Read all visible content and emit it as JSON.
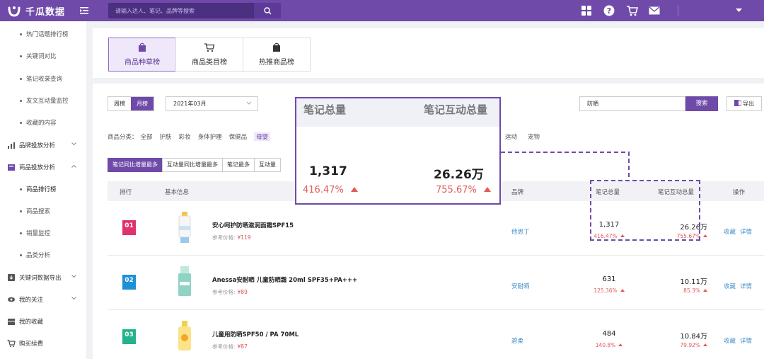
{
  "app": {
    "brand": "千瓜数据"
  },
  "search": {
    "placeholder": "请输入达人、笔记、品牌等搜索"
  },
  "sidebar": {
    "items": [
      {
        "label": "热门话题排行榜",
        "type": "sub"
      },
      {
        "label": "关键词对比",
        "type": "sub"
      },
      {
        "label": "笔记收录查询",
        "type": "sub"
      },
      {
        "label": "发文互动量监控",
        "type": "sub"
      },
      {
        "label": "收藏的内容",
        "type": "sub"
      },
      {
        "label": "品牌投放分析",
        "type": "group"
      },
      {
        "label": "商品投放分析",
        "type": "group"
      },
      {
        "label": "商品排行榜",
        "type": "sub"
      },
      {
        "label": "商品搜索",
        "type": "sub"
      },
      {
        "label": "销量监控",
        "type": "sub"
      },
      {
        "label": "品类分析",
        "type": "sub"
      },
      {
        "label": "关键词数据导出",
        "type": "group"
      },
      {
        "label": "我的关注",
        "type": "group"
      },
      {
        "label": "我的收藏",
        "type": "group"
      },
      {
        "label": "购买续费",
        "type": "group"
      }
    ]
  },
  "top_tabs": [
    {
      "label": "商品种草榜",
      "active": true,
      "icon": "shopping-bag-icon"
    },
    {
      "label": "商品类目榜",
      "active": false,
      "icon": "cart-icon"
    },
    {
      "label": "热推商品榜",
      "active": false,
      "icon": "bag-icon"
    }
  ],
  "filters": {
    "period_week": "周榜",
    "period_month": "月榜",
    "month_value": "2021年03月",
    "keyword_value": "防晒",
    "search_label": "搜索",
    "export_label": "导出"
  },
  "categories": {
    "label": "商品分类：",
    "items": [
      "全部",
      "护肤",
      "彩妆",
      "身体护理",
      "保健品",
      "母婴"
    ],
    "active": "母婴",
    "tail": [
      "运动",
      "宠物"
    ]
  },
  "sort_tabs": [
    "笔记同比增量最多",
    "互动量同比增量最多",
    "笔记最多",
    "互动量"
  ],
  "table": {
    "headers": {
      "rank": "排行",
      "info": "基本信息",
      "brand": "品牌",
      "notes": "笔记总量",
      "interactions": "笔记互动总量",
      "ops": "操作"
    },
    "price_label": "参考价格:",
    "op_fav": "收藏",
    "op_detail": "详情",
    "rows": [
      {
        "rank": "01",
        "name": "安心呵护防晒滋润面霜SPF15",
        "price": "¥119",
        "brand": "他思丁",
        "notes": "1,317",
        "notes_pct": "416.47%",
        "inter": "26.26万",
        "inter_pct": "755.67%",
        "badge": "#e0336b"
      },
      {
        "rank": "02",
        "name": "Anessa安耐晒 儿童防晒霜 20ml SPF35+PA+++",
        "price": "¥89",
        "brand": "安耐晒",
        "notes": "631",
        "notes_pct": "125.36%",
        "inter": "10.11万",
        "inter_pct": "85.3%",
        "badge": "#1f8fd6"
      },
      {
        "rank": "03",
        "name": "儿童用防晒SPF50 / PA 70ML",
        "price": "¥87",
        "brand": "碧柔",
        "notes": "484",
        "notes_pct": "140.8%",
        "inter": "10.84万",
        "inter_pct": "79.92%",
        "badge": "#24b38a"
      }
    ]
  },
  "callout": {
    "h1": "笔记总量",
    "h2": "笔记互动总量",
    "v1": "1,317",
    "p1": "416.47%",
    "v2": "26.26万",
    "p2": "755.67%"
  },
  "colors": {
    "accent": "#6f4aa8",
    "up": "#e05a5a",
    "link": "#4a90c8"
  }
}
